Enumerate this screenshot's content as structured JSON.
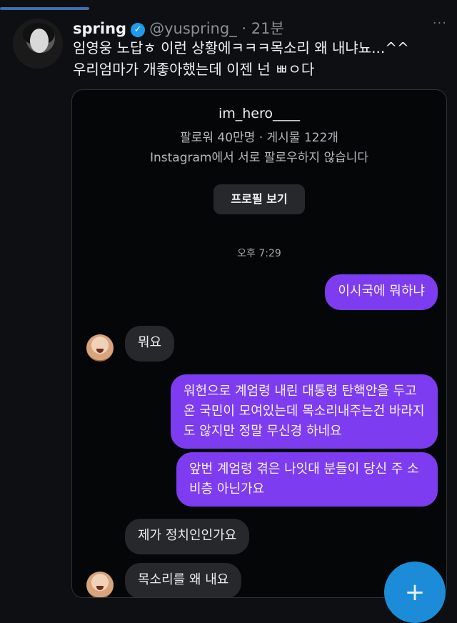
{
  "tweet": {
    "author_name": "spring",
    "handle_time": "@yuspring_ · 21분",
    "more_label": "···",
    "lines": [
      "임영웅 노답ㅎ 이런 상황에ㅋㅋㅋ목소리 왜 내냐뇨...^^",
      "우리엄마가 개좋아했는데 이젠 넌 ㅃㅇ다"
    ]
  },
  "instagram": {
    "profile_name": "",
    "username": "im_hero____",
    "stats": "팔로워 40만명 · 게시물 122개",
    "follow_note": "Instagram에서 서로 팔로우하지 않습니다",
    "profile_button": "프로필 보기",
    "timestamp": "오후 7:29",
    "messages": [
      {
        "from": "me",
        "text": "이시국에 뭐하냐"
      },
      {
        "from": "them",
        "text": "뭐요"
      },
      {
        "from": "me",
        "text": "워헌으로 계엄령 내린 대통령 탄핵안을 두고 온 국민이 모여있는데 목소리내주는건 바라지도 않지만 정말 무신경 하네요"
      },
      {
        "from": "me",
        "text": "앞번 계엄령 겪은 나잇대 분들이 당신 주 소비층 아닌가요"
      },
      {
        "from": "them",
        "text": "제가 정치인인가요"
      },
      {
        "from": "them",
        "text": "목소리를 왜 내요"
      }
    ]
  },
  "fab": {
    "label": "+"
  },
  "colors": {
    "outgoing": "#7d3cf0",
    "incoming": "#26282c",
    "accent": "#1d9bf0",
    "background": "#0d0f12"
  }
}
